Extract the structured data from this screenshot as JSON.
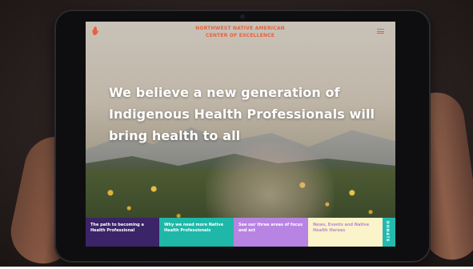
{
  "header": {
    "org_name_line1": "NORTHWEST NATIVE AMERICAN",
    "org_name_line2": "CENTER OF EXCELLENCE",
    "logo_icon": "hand-logo-icon",
    "menu_icon": "hamburger-menu-icon"
  },
  "hero": {
    "heading": "We believe a new generation of Indigenous Health Professionals will bring health to all"
  },
  "nav_cards": [
    {
      "label": "The path to becoming a Health Professional",
      "color": "#3b2468"
    },
    {
      "label": "Why we need more Native Health Professionals",
      "color": "#1fb7a8"
    },
    {
      "label": "See our three areas of focus and act",
      "color": "#b884e3"
    },
    {
      "label": "News, Events and Native Health Heroes",
      "color": "#fbf3c9"
    }
  ],
  "donate": {
    "label": "DONATE",
    "color": "#24b9ae"
  },
  "colors": {
    "accent": "#e8613a",
    "white": "#ffffff"
  }
}
